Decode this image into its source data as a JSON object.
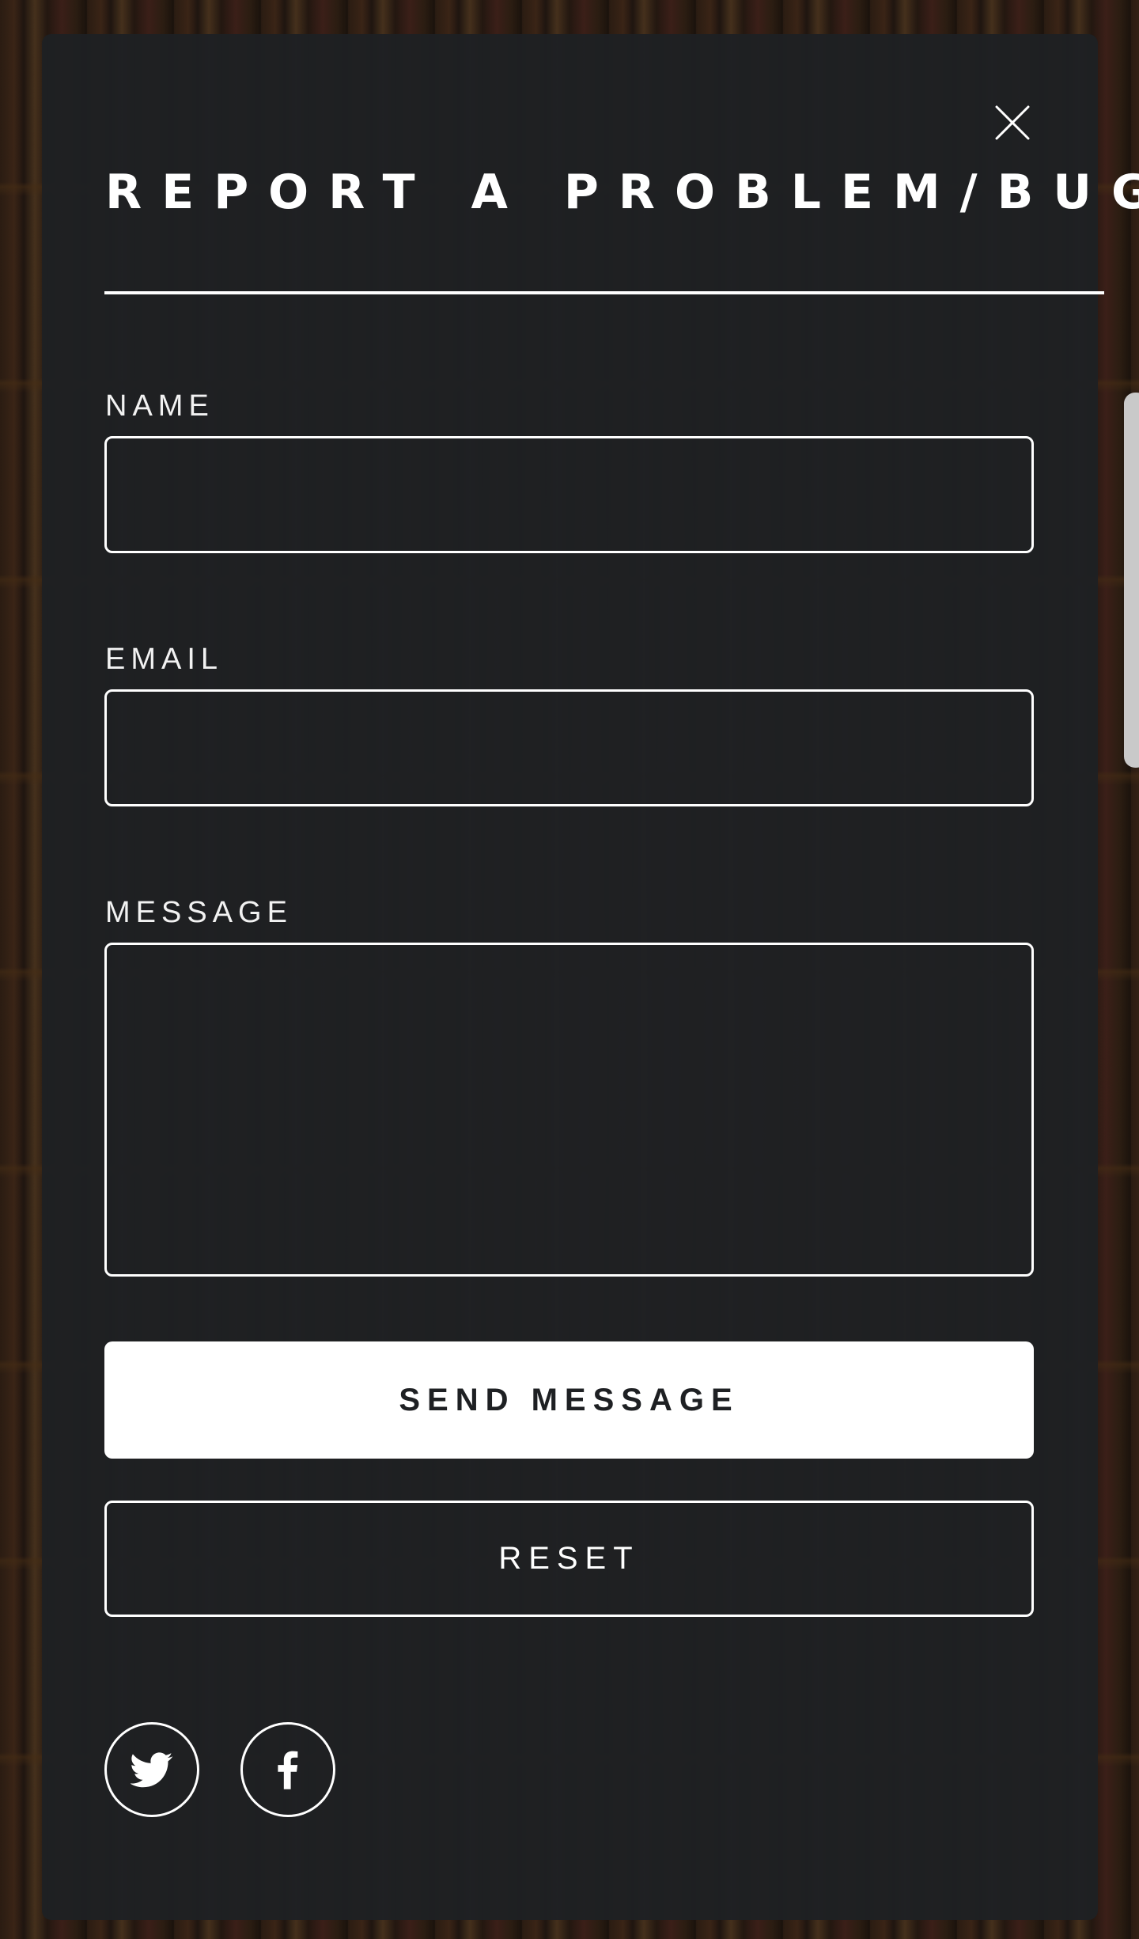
{
  "modal": {
    "title": "REPORT A PROBLEM/BUG",
    "close_icon": "close-icon"
  },
  "form": {
    "name_label": "NAME",
    "name_value": "",
    "email_label": "EMAIL",
    "email_value": "",
    "message_label": "MESSAGE",
    "message_value": "",
    "send_label": "SEND MESSAGE",
    "reset_label": "RESET"
  },
  "social": {
    "items": [
      {
        "icon": "twitter-icon"
      },
      {
        "icon": "facebook-icon"
      }
    ]
  },
  "colors": {
    "panel_background": "#1e2023",
    "foreground": "#ffffff",
    "button_text": "#1e2023"
  }
}
